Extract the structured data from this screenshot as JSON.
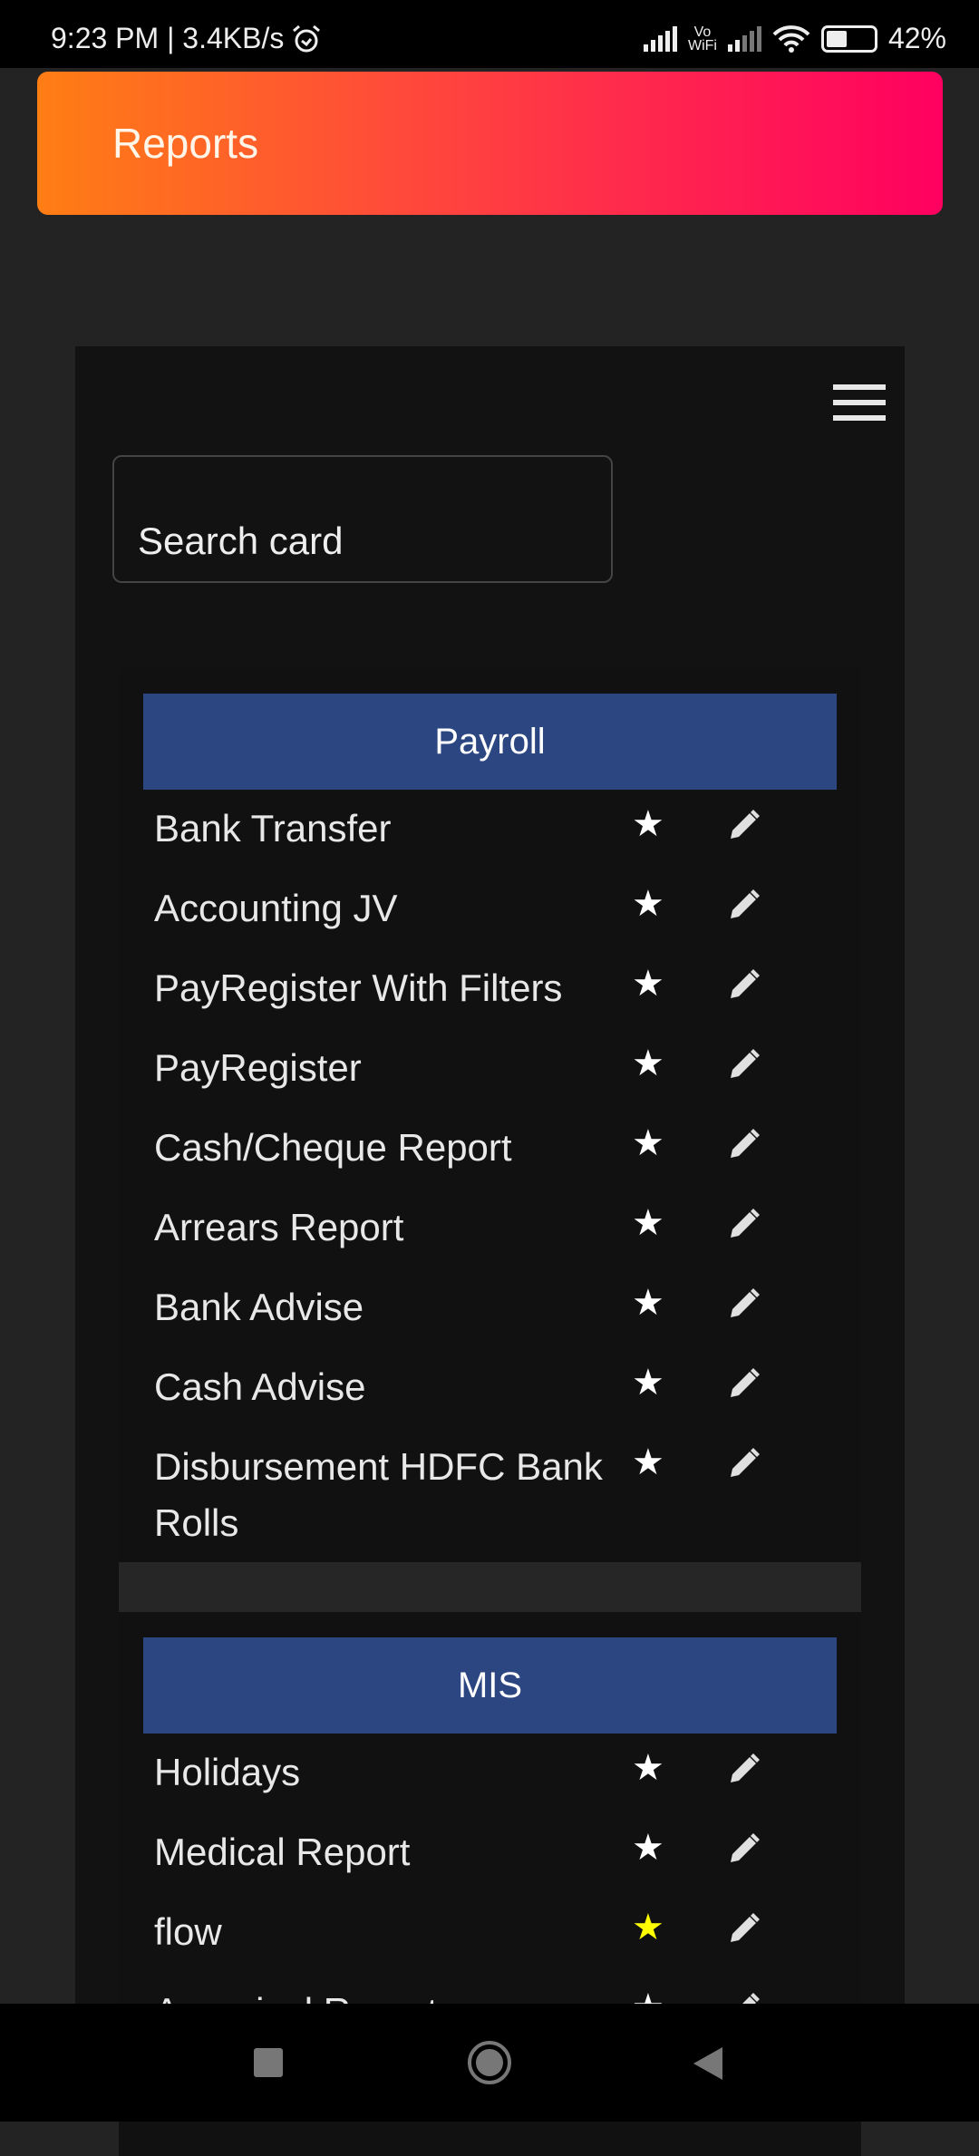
{
  "status_bar": {
    "left": "9:23 PM | 3.4KB/s",
    "vo": "Vo",
    "wifi": "WiFi",
    "battery": "42%"
  },
  "header": {
    "title": "Reports"
  },
  "search": {
    "placeholder": "Search card"
  },
  "colors": {
    "accent_start": "#ff7e14",
    "accent_end": "#ff0060",
    "section_header": "#2c4682",
    "favorite_active": "#ffff00"
  },
  "sections": [
    {
      "title": "Payroll",
      "items": [
        {
          "label": "Bank Transfer",
          "favorite": false
        },
        {
          "label": "Accounting JV",
          "favorite": false
        },
        {
          "label": "PayRegister With Filters",
          "favorite": false
        },
        {
          "label": "PayRegister",
          "favorite": false
        },
        {
          "label": "Cash/Cheque Report",
          "favorite": false
        },
        {
          "label": "Arrears Report",
          "favorite": false
        },
        {
          "label": "Bank Advise",
          "favorite": false
        },
        {
          "label": "Cash Advise",
          "favorite": false
        },
        {
          "label": "Disbursement HDFC Bank Rolls",
          "favorite": false
        }
      ]
    },
    {
      "title": "MIS",
      "items": [
        {
          "label": "Holidays",
          "favorite": false
        },
        {
          "label": "Medical Report",
          "favorite": false
        },
        {
          "label": "flow",
          "favorite": true
        },
        {
          "label": "Appraisal Report",
          "favorite": false
        }
      ]
    }
  ]
}
